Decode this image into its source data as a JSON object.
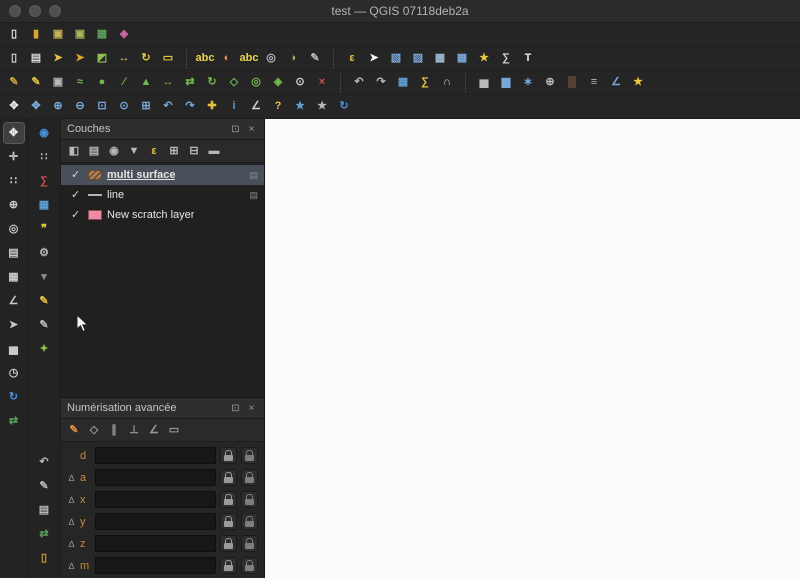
{
  "window": {
    "title": "test — QGIS 07118deb2a"
  },
  "ui": {
    "dock_glyph": "⊡",
    "close_glyph": "×",
    "check_glyph": "✓",
    "delta_glyph": "∆",
    "indicator_glyph": "▤"
  },
  "colors": {
    "selection_highlight": "#4a505b",
    "canvas": "#fbfbfb",
    "adv_label": "#c98a3e",
    "scratch_pink": "#ee8ba0",
    "multi_surface_swatch": "#b5835a",
    "line_swatch": "#b5b5b5"
  },
  "toolbars": {
    "row1": [
      {
        "name": "new-project-icon",
        "glyph": "▯",
        "color": "#e6e6e6"
      },
      {
        "name": "open-project-icon",
        "glyph": "▮",
        "color": "#d9a62e"
      },
      {
        "name": "save-project-icon",
        "glyph": "▣",
        "color": "#c5b358"
      },
      {
        "name": "save-project-as-icon",
        "glyph": "▣",
        "color": "#a8b457"
      },
      {
        "name": "data-source-manager-icon",
        "glyph": "▦",
        "color": "#5aa05a"
      },
      {
        "name": "style-manager-icon",
        "glyph": "◈",
        "color": "#cf6ba9"
      }
    ],
    "row2_left": [
      {
        "name": "new-print-layout-icon",
        "glyph": "▯",
        "color": "#d8d8d8"
      },
      {
        "name": "layout-manager-icon",
        "glyph": "▤",
        "color": "#d8d8d8"
      },
      {
        "name": "highlight-pinned-labels-icon",
        "glyph": "➤",
        "color": "#e3c33f"
      },
      {
        "name": "pin-labels-icon",
        "glyph": "➤",
        "color": "#d9a62e"
      },
      {
        "name": "show-hidden-labels-icon",
        "glyph": "◩",
        "color": "#8fbf4d"
      },
      {
        "name": "move-label-icon",
        "glyph": "↔",
        "color": "#e3c33f"
      },
      {
        "name": "rotate-label-icon",
        "glyph": "↻",
        "color": "#e3c33f"
      },
      {
        "name": "change-label-icon",
        "glyph": "▭",
        "color": "#e3c33f"
      }
    ],
    "row2_mid": [
      {
        "name": "layer-labeling-icon",
        "glyph": "abc",
        "color": "#e9d44a"
      },
      {
        "name": "layer-diagram-icon",
        "glyph": "◐",
        "color": "#e98a5a"
      },
      {
        "name": "labeling-rules-icon",
        "glyph": "abc",
        "color": "#e9d44a"
      },
      {
        "name": "label-engine-settings-icon",
        "glyph": "◎",
        "color": "#b9b9b9"
      },
      {
        "name": "diagram-options-icon",
        "glyph": "◑",
        "color": "#8fbf4d"
      },
      {
        "name": "annotation-toolbar-icon",
        "glyph": "✎",
        "color": "#b9b9b9"
      }
    ],
    "row2_right": [
      {
        "name": "select-by-expression-icon",
        "glyph": "ε",
        "color": "#e3c33f"
      },
      {
        "name": "pointer-icon",
        "glyph": "➤",
        "color": "#f2f2f2"
      },
      {
        "name": "select-features-icon",
        "glyph": "▧",
        "color": "#79a8d8"
      },
      {
        "name": "select-by-polygon-icon",
        "glyph": "▨",
        "color": "#79a8d8"
      },
      {
        "name": "deselect-features-icon",
        "glyph": "▩",
        "color": "#9fb7cf"
      },
      {
        "name": "select-all-icon",
        "glyph": "▦",
        "color": "#79a8d8"
      },
      {
        "name": "favorites-icon",
        "glyph": "★",
        "color": "#e8c63f"
      },
      {
        "name": "statistical-summary-icon",
        "glyph": "∑",
        "color": "#d0d0d0"
      },
      {
        "name": "text-annotation-icon",
        "glyph": "T",
        "color": "#e6e6e6"
      }
    ],
    "row3_left": [
      {
        "name": "current-edits-icon",
        "glyph": "✎",
        "color": "#caa23a"
      },
      {
        "name": "toggle-editing-icon",
        "glyph": "✎",
        "color": "#e3c33f"
      },
      {
        "name": "save-layer-edits-icon",
        "glyph": "▣",
        "color": "#b9b9b9"
      },
      {
        "name": "stream-digitizing-icon",
        "glyph": "≈",
        "color": "#74b84e"
      },
      {
        "name": "add-point-feature-icon",
        "glyph": "●",
        "color": "#74b84e"
      },
      {
        "name": "add-line-feature-icon",
        "glyph": "∕",
        "color": "#74b84e"
      },
      {
        "name": "add-polygon-feature-icon",
        "glyph": "▲",
        "color": "#74b84e"
      },
      {
        "name": "move-feature-icon",
        "glyph": "↔",
        "color": "#74b84e"
      },
      {
        "name": "copy-move-feature-icon",
        "glyph": "⇄",
        "color": "#74b84e"
      },
      {
        "name": "rotate-feature-icon",
        "glyph": "↻",
        "color": "#74b84e"
      },
      {
        "name": "simplify-feature-icon",
        "glyph": "◇",
        "color": "#74b84e"
      },
      {
        "name": "add-ring-icon",
        "glyph": "◎",
        "color": "#74b84e"
      },
      {
        "name": "add-part-icon",
        "glyph": "◈",
        "color": "#74b84e"
      },
      {
        "name": "vertex-tool-icon",
        "glyph": "⊙",
        "color": "#d0d0d0"
      },
      {
        "name": "delete-selected-icon",
        "glyph": "×",
        "color": "#d05050"
      }
    ],
    "row3_mid": [
      {
        "name": "undo-icon",
        "glyph": "↶",
        "color": "#b9b9b9"
      },
      {
        "name": "redo-icon",
        "glyph": "↷",
        "color": "#b9b9b9"
      },
      {
        "name": "attribute-table-icon",
        "glyph": "▦",
        "color": "#5e9fd4"
      },
      {
        "name": "field-calculator-icon",
        "glyph": "∑",
        "color": "#e3c33f"
      },
      {
        "name": "snapping-options-icon",
        "glyph": "∩",
        "color": "#d0d0d0"
      }
    ],
    "row3_right": [
      {
        "name": "statistics-panel-icon",
        "glyph": "▅",
        "color": "#b9b9b9"
      },
      {
        "name": "histogram-icon",
        "glyph": "▆",
        "color": "#79a8d8"
      },
      {
        "name": "scatter-plot-icon",
        "glyph": "∗",
        "color": "#79a8d8"
      },
      {
        "name": "mean-coordinates-icon",
        "glyph": "⊕",
        "color": "#b9b9b9"
      },
      {
        "name": "heatmap-icon",
        "glyph": "▒",
        "color": "#e08a5a"
      },
      {
        "name": "contour-icon",
        "glyph": "≡",
        "color": "#b9b9b9"
      },
      {
        "name": "profile-tool-icon",
        "glyph": "∠",
        "color": "#79a8d8"
      },
      {
        "name": "favorites-secondary-icon",
        "glyph": "★",
        "color": "#e8c63f"
      }
    ],
    "row4": [
      {
        "name": "pan-map-icon",
        "glyph": "✥",
        "color": "#e6e6e6"
      },
      {
        "name": "pan-to-selection-icon",
        "glyph": "✥",
        "color": "#79a8d8"
      },
      {
        "name": "zoom-in-icon",
        "glyph": "⊕",
        "color": "#79a8d8"
      },
      {
        "name": "zoom-out-icon",
        "glyph": "⊖",
        "color": "#79a8d8"
      },
      {
        "name": "zoom-full-icon",
        "glyph": "⊡",
        "color": "#79a8d8"
      },
      {
        "name": "zoom-to-selection-icon",
        "glyph": "⊙",
        "color": "#79a8d8"
      },
      {
        "name": "zoom-to-layer-icon",
        "glyph": "⊞",
        "color": "#79a8d8"
      },
      {
        "name": "zoom-last-icon",
        "glyph": "↶",
        "color": "#79a8d8"
      },
      {
        "name": "zoom-next-icon",
        "glyph": "↷",
        "color": "#79a8d8"
      },
      {
        "name": "new-3d-map-view-icon",
        "glyph": "✚",
        "color": "#e3c33f"
      },
      {
        "name": "identify-features-icon",
        "glyph": "i",
        "color": "#5e9fd4"
      },
      {
        "name": "measure-line-icon",
        "glyph": "∠",
        "color": "#d0d0d0"
      },
      {
        "name": "map-tips-icon",
        "glyph": "?",
        "color": "#e3c33f"
      },
      {
        "name": "new-bookmark-icon",
        "glyph": "★",
        "color": "#5e9fd4"
      },
      {
        "name": "show-bookmarks-icon",
        "glyph": "★",
        "color": "#b9b9b9"
      },
      {
        "name": "refresh-map-icon",
        "glyph": "↻",
        "color": "#4a90d9"
      }
    ]
  },
  "left_toolbar_a": [
    {
      "name": "pan-hand-icon",
      "glyph": "✥",
      "color": "#e8e8e8",
      "active": true
    },
    {
      "name": "pan-arrows-icon",
      "glyph": "✛",
      "color": "#c9c9c9"
    },
    {
      "name": "dot-matrix-icon",
      "glyph": "∷",
      "color": "#c9c9c9"
    },
    {
      "name": "magnifier-icon",
      "glyph": "⊕",
      "color": "#c9c9c9"
    },
    {
      "name": "target-icon",
      "glyph": "◎",
      "color": "#c9c9c9"
    },
    {
      "name": "layers-stack-icon",
      "glyph": "▤",
      "color": "#c9c9c9"
    },
    {
      "name": "color-swatches-icon",
      "glyph": "▦",
      "color": "#c9c9c9"
    },
    {
      "name": "ruler-icon",
      "glyph": "∠",
      "color": "#c9c9c9"
    },
    {
      "name": "pin-icon",
      "glyph": "➤",
      "color": "#c9c9c9"
    },
    {
      "name": "chart-icon",
      "glyph": "▅",
      "color": "#c9c9c9"
    },
    {
      "name": "clock-icon",
      "glyph": "◷",
      "color": "#c9c9c9"
    },
    {
      "name": "refresh-icon",
      "glyph": "↻",
      "color": "#4a90d9"
    },
    {
      "name": "sync-icon",
      "glyph": "⇄",
      "color": "#58a058"
    }
  ],
  "left_toolbar_b_top": [
    {
      "name": "zoom-actual-icon",
      "glyph": "◉",
      "color": "#4a90d9"
    },
    {
      "name": "dot-grid-icon",
      "glyph": "∷",
      "color": "#b9b9b9"
    },
    {
      "name": "sigma-statistics-icon",
      "glyph": "∑",
      "color": "#d05050"
    },
    {
      "name": "attribute-table-icon",
      "glyph": "▦",
      "color": "#5e9fd4"
    },
    {
      "name": "map-tips-icon",
      "glyph": "❞",
      "color": "#e3c33f"
    },
    {
      "name": "processing-gear-icon",
      "glyph": "⚙",
      "color": "#b9b9b9"
    },
    {
      "name": "gear-caret-icon",
      "glyph": "▾",
      "color": "#8a8a8a"
    },
    {
      "name": "edit-pencil-icon",
      "glyph": "✎",
      "color": "#e3c33f"
    },
    {
      "name": "sketch-pencil-icon",
      "glyph": "✎",
      "color": "#b9b9b9"
    },
    {
      "name": "marker-icon",
      "glyph": "✦",
      "color": "#8fbf4d"
    }
  ],
  "left_toolbar_b_bottom": [
    {
      "name": "undo-history-icon",
      "glyph": "↶",
      "color": "#b9b9b9"
    },
    {
      "name": "annotation-pencil-icon",
      "glyph": "✎",
      "color": "#b9b9b9"
    },
    {
      "name": "log-book-icon",
      "glyph": "▤",
      "color": "#b9b9b9"
    },
    {
      "name": "sync-arrows-icon",
      "glyph": "⇄",
      "color": "#58a058"
    },
    {
      "name": "clipboard-icon",
      "glyph": "▯",
      "color": "#caa23a"
    }
  ],
  "panels": {
    "layers": {
      "title": "Couches",
      "toolbar": [
        {
          "name": "open-layer-styling-icon",
          "glyph": "◧",
          "color": "#b8b8b8"
        },
        {
          "name": "add-group-icon",
          "glyph": "▤",
          "color": "#b8b8b8"
        },
        {
          "name": "manage-map-themes-icon",
          "glyph": "◉",
          "color": "#b8b8b8"
        },
        {
          "name": "filter-legend-icon",
          "glyph": "▼",
          "color": "#b8b8b8"
        },
        {
          "name": "filter-by-expression-icon",
          "glyph": "ε",
          "color": "#e3c33f"
        },
        {
          "name": "expand-all-icon",
          "glyph": "⊞",
          "color": "#b8b8b8"
        },
        {
          "name": "collapse-all-icon",
          "glyph": "⊟",
          "color": "#b8b8b8"
        },
        {
          "name": "remove-layer-icon",
          "glyph": "▬",
          "color": "#b8b8b8"
        }
      ],
      "items": [
        {
          "label": "multi surface",
          "checked": true,
          "selected": true,
          "swatch": "hatch",
          "swatch_color": "#b5835a",
          "indicator": true
        },
        {
          "label": "line",
          "checked": true,
          "selected": false,
          "swatch": "line",
          "swatch_color": "",
          "indicator": true
        },
        {
          "label": "New scratch layer",
          "checked": true,
          "selected": false,
          "swatch": "fill",
          "swatch_color": "#ee8ba0",
          "indicator": false
        }
      ]
    },
    "advanced": {
      "title": "Numérisation avancée",
      "toolbar": [
        {
          "name": "enable-advanced-digitizing-icon",
          "glyph": "✎",
          "color": "#e08b3c"
        },
        {
          "name": "construction-mode-icon",
          "glyph": "◇",
          "color": "#9a9a9a"
        },
        {
          "name": "parallel-icon",
          "glyph": "∥",
          "color": "#9a9a9a"
        },
        {
          "name": "perpendicular-icon",
          "glyph": "⊥",
          "color": "#9a9a9a"
        },
        {
          "name": "snap-angles-icon",
          "glyph": "∠",
          "color": "#9a9a9a"
        },
        {
          "name": "floater-icon",
          "glyph": "▭",
          "color": "#9a9a9a"
        }
      ],
      "rows": [
        {
          "label": "d",
          "delta": false,
          "input_name": "distance-input",
          "value": ""
        },
        {
          "label": "a",
          "delta": true,
          "input_name": "angle-input",
          "value": ""
        },
        {
          "label": "x",
          "delta": true,
          "input_name": "x-input",
          "value": ""
        },
        {
          "label": "y",
          "delta": true,
          "input_name": "y-input",
          "value": ""
        },
        {
          "label": "z",
          "delta": true,
          "input_name": "z-input",
          "value": ""
        },
        {
          "label": "m",
          "delta": true,
          "input_name": "m-input",
          "value": ""
        }
      ]
    }
  }
}
